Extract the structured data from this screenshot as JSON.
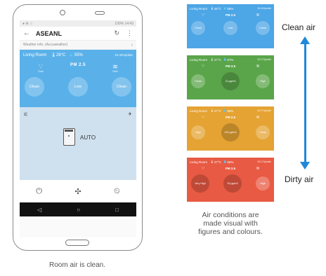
{
  "phone": {
    "status_time": "14:43",
    "status_battery": "100%",
    "app_title": "ASEANL",
    "weather_label": "Weather info. (Accuweather)",
    "room": {
      "name": "Living Room",
      "temperature": "28°C",
      "humidity": "55%",
      "update": "15:40Update",
      "icon_labels": [
        "Dust",
        "PM 2.5",
        "Odor"
      ],
      "pm_label": "PM 2.5",
      "buttons": [
        "Clean",
        "Low",
        "Clean"
      ]
    },
    "mode_label": "AUTO",
    "caption": "Room air is clean."
  },
  "cards": [
    {
      "room": "Living Room",
      "temp": "28°C",
      "hum": "55%",
      "update": "15:40Update",
      "pm": "PM 2.5",
      "circles": [
        "Clean",
        "Low",
        "Clean"
      ],
      "center_big": false,
      "color": "#4da6e6"
    },
    {
      "room": "Living Room",
      "temp": "27°C",
      "hum": "67%",
      "update": "15:17Update",
      "pm": "PM 2.5",
      "circles": [
        "Clean",
        "12 µg/m3",
        "High"
      ],
      "center_big": true,
      "color": "#5aa54a"
    },
    {
      "room": "Living Room",
      "temp": "27°C",
      "hum": "65%",
      "update": "15:17Update",
      "pm": "PM 2.5",
      "circles": [
        "High",
        "222 µg/m3",
        "Clean"
      ],
      "center_big": true,
      "color": "#e5a333"
    },
    {
      "room": "Living Room",
      "temp": "27°C",
      "hum": "66%",
      "update": "15:17Update",
      "pm": "PM 2.5",
      "circles": [
        "Very High",
        "93 µg/m3",
        "High"
      ],
      "center_big": true,
      "color": "#e85a43"
    }
  ],
  "scale": {
    "top_label": "Clean air",
    "bottom_label": "Dirty air",
    "color": "#1e88d9"
  },
  "right_caption": [
    "Air conditions are",
    "made visual with",
    "figures and colours."
  ]
}
